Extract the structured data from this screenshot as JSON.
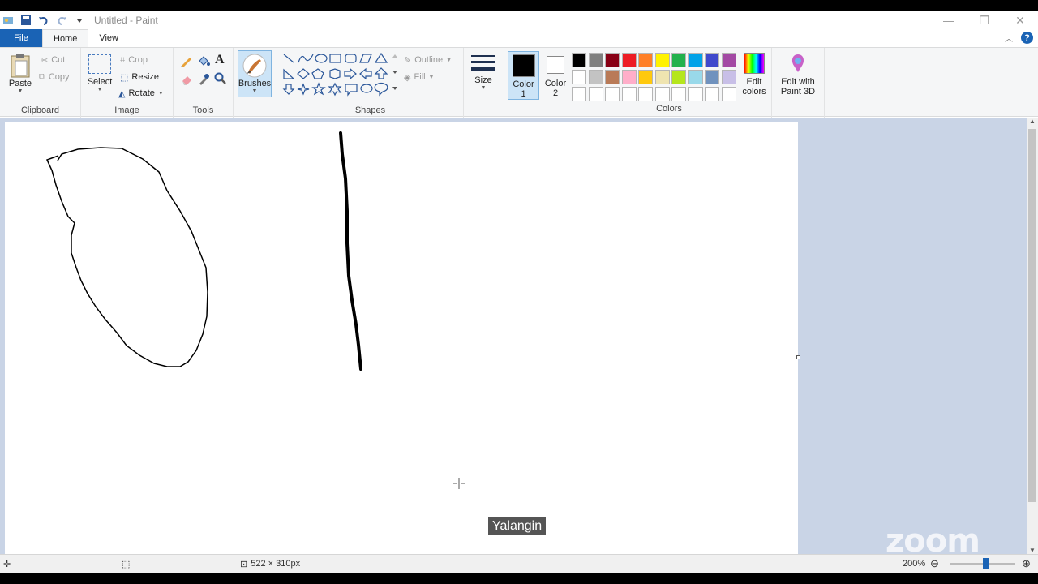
{
  "window": {
    "title": "Untitled - Paint"
  },
  "tabs": {
    "file": "File",
    "home": "Home",
    "view": "View"
  },
  "clipboard": {
    "paste": "Paste",
    "cut": "Cut",
    "copy": "Copy",
    "group": "Clipboard"
  },
  "image": {
    "select": "Select",
    "crop": "Crop",
    "resize": "Resize",
    "rotate": "Rotate",
    "group": "Image"
  },
  "tools": {
    "group": "Tools"
  },
  "brushes": {
    "label": "Brushes"
  },
  "shapes": {
    "outline": "Outline",
    "fill": "Fill",
    "group": "Shapes"
  },
  "size": {
    "label": "Size"
  },
  "color1": {
    "label": "Color",
    "num": "1",
    "value": "#000000"
  },
  "color2": {
    "label": "Color",
    "num": "2",
    "value": "#ffffff"
  },
  "colors": {
    "group": "Colors",
    "edit": "Edit colors",
    "edit3d": "Edit with Paint 3D",
    "palette": [
      "#000000",
      "#7f7f7f",
      "#880015",
      "#ed1c24",
      "#ff7f27",
      "#fff200",
      "#22b14c",
      "#00a2e8",
      "#3f48cc",
      "#a349a4",
      "#ffffff",
      "#c3c3c3",
      "#b97a57",
      "#ffaec9",
      "#ffc90e",
      "#efe4b0",
      "#b5e61d",
      "#99d9ea",
      "#7092be",
      "#c8bfe7",
      "#ffffff",
      "#ffffff",
      "#ffffff",
      "#ffffff",
      "#ffffff",
      "#ffffff",
      "#ffffff",
      "#ffffff",
      "#ffffff",
      "#ffffff"
    ]
  },
  "status": {
    "dimensions": "522 × 310px",
    "zoom": "200%"
  },
  "overlay": {
    "participant": "Yalangin",
    "logo": "zoom"
  }
}
